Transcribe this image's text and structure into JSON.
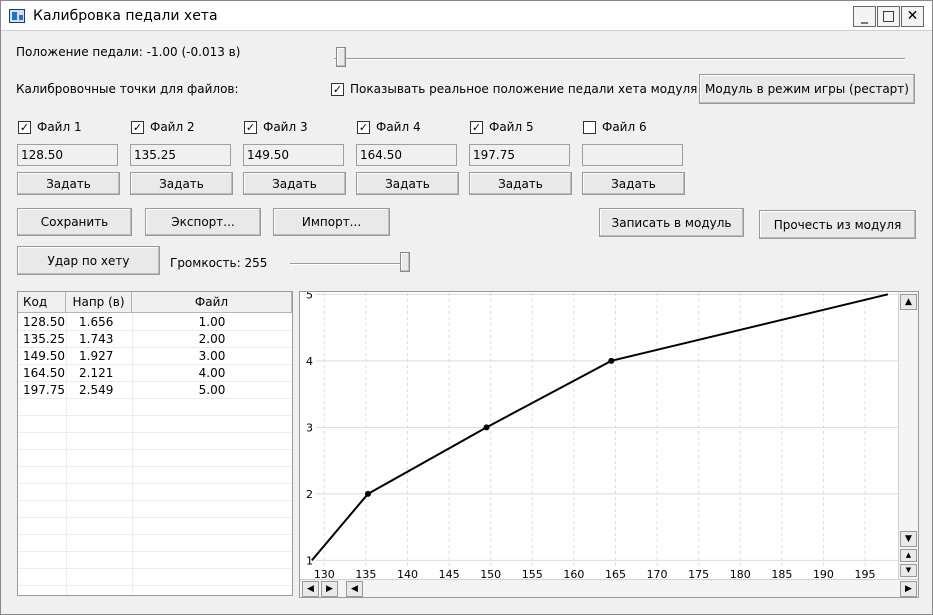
{
  "window": {
    "title": "Калибровка педали хета",
    "minimize": "_",
    "maximize": "□",
    "close": "✕"
  },
  "pedal": {
    "label": "Положение педали: -1.00  (-0.013 в)"
  },
  "calib": {
    "label": "Калибровочные точки для файлов:",
    "show_real": {
      "label": "Показывать реальное положение педали хета модуля",
      "checked": true
    },
    "game_mode_button": "Модуль в режим игры (рестарт)"
  },
  "files": [
    {
      "label": "Файл 1",
      "checked": true,
      "value": "128.50",
      "set": "Задать"
    },
    {
      "label": "Файл 2",
      "checked": true,
      "value": "135.25",
      "set": "Задать"
    },
    {
      "label": "Файл 3",
      "checked": true,
      "value": "149.50",
      "set": "Задать"
    },
    {
      "label": "Файл 4",
      "checked": true,
      "value": "164.50",
      "set": "Задать"
    },
    {
      "label": "Файл 5",
      "checked": true,
      "value": "197.75",
      "set": "Задать"
    },
    {
      "label": "Файл 6",
      "checked": false,
      "value": "",
      "set": "Задать"
    }
  ],
  "actions": {
    "save": "Сохранить",
    "export": "Экспорт...",
    "import": "Импорт...",
    "write": "Записать в модуль",
    "read": "Прочесть из модуля",
    "hit": "Удар по хету",
    "volume_label": "Громкость: 255",
    "volume_fraction": 1.0
  },
  "table": {
    "columns": [
      "Код",
      "Напр (в)",
      "Файл"
    ],
    "rows": [
      [
        "128.50",
        "1.656",
        "1.00"
      ],
      [
        "135.25",
        "1.743",
        "2.00"
      ],
      [
        "149.50",
        "1.927",
        "3.00"
      ],
      [
        "164.50",
        "2.121",
        "4.00"
      ],
      [
        "197.75",
        "2.549",
        "5.00"
      ]
    ]
  },
  "scroll_glyphs": {
    "up": "▲",
    "down": "▼",
    "left": "◀",
    "right": "▶"
  },
  "chart_data": {
    "type": "line",
    "x": [
      128.5,
      135.25,
      149.5,
      164.5,
      197.75
    ],
    "y": [
      1,
      2,
      3,
      4,
      5
    ],
    "xlim": [
      129,
      198
    ],
    "ylim": [
      0.9,
      5.02
    ],
    "x_ticks": [
      130,
      135,
      140,
      145,
      150,
      155,
      160,
      165,
      170,
      175,
      180,
      185,
      190,
      195
    ],
    "y_ticks": [
      1,
      2,
      3,
      4,
      5
    ],
    "grid": true,
    "line_color": "#000000",
    "grid_color": "#dcdcdc"
  }
}
